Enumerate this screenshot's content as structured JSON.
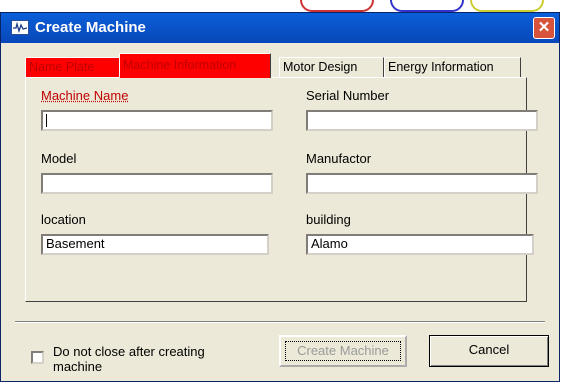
{
  "window": {
    "title": "Create Machine",
    "close_symbol": "✕"
  },
  "tabs": [
    {
      "label": "Name Plate",
      "highlight": "red"
    },
    {
      "label": "Machine Information",
      "highlight": "red",
      "active": true
    },
    {
      "label": "Motor Design"
    },
    {
      "label": "Energy Information"
    }
  ],
  "form": {
    "machine_name": {
      "label": "Machine Name",
      "value": ""
    },
    "serial_number": {
      "label": "Serial Number",
      "value": ""
    },
    "model": {
      "label": "Model",
      "value": ""
    },
    "manufactor": {
      "label": "Manufactor",
      "value": ""
    },
    "location": {
      "label": "location",
      "value": "Basement"
    },
    "building": {
      "label": "building",
      "value": "Alamo"
    }
  },
  "footer": {
    "checkbox_label": "Do not close after creating machine",
    "checkbox_checked": false,
    "create_button": "Create Machine",
    "cancel_button": "Cancel"
  },
  "colors": {
    "title_bar": "#0a5fd9",
    "tab_highlight": "#ff0000",
    "label_highlight": "#c00000",
    "close_button": "#d8533c"
  },
  "icons": {
    "window_icon": "waveform-icon",
    "close_icon": "close-icon"
  }
}
